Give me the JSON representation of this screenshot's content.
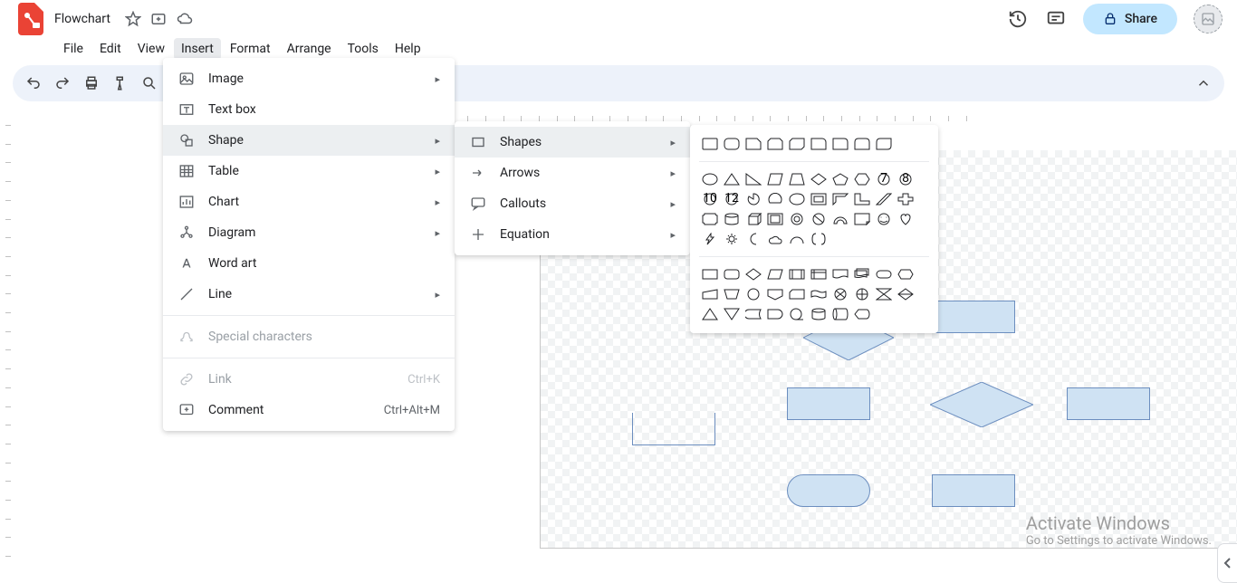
{
  "header": {
    "doc_title": "Flowchart",
    "share_label": "Share"
  },
  "menubar": {
    "file": "File",
    "edit": "Edit",
    "view": "View",
    "insert": "Insert",
    "format": "Format",
    "arrange": "Arrange",
    "tools": "Tools",
    "help": "Help"
  },
  "insert_menu": {
    "image": "Image",
    "textbox": "Text box",
    "shape": "Shape",
    "table": "Table",
    "chart": "Chart",
    "diagram": "Diagram",
    "wordart": "Word art",
    "line": "Line",
    "special": "Special characters",
    "link": "Link",
    "link_shortcut": "Ctrl+K",
    "comment": "Comment",
    "comment_shortcut": "Ctrl+Alt+M"
  },
  "shape_menu": {
    "shapes": "Shapes",
    "arrows": "Arrows",
    "callouts": "Callouts",
    "equation": "Equation"
  },
  "watermark": {
    "title": "Activate Windows",
    "sub": "Go to Settings to activate Windows."
  }
}
